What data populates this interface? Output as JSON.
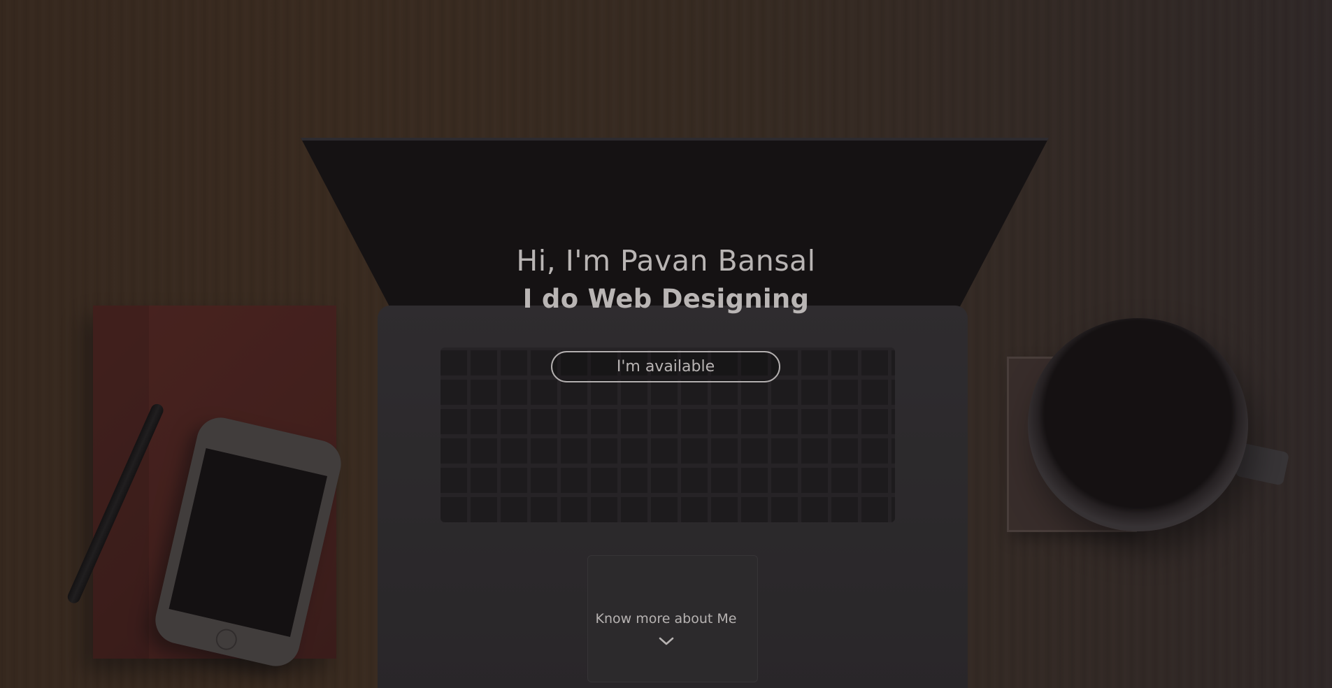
{
  "hero": {
    "greeting": "Hi, I'm Pavan Bansal",
    "tagline": "I do Web Designing",
    "cta_label": "I'm available",
    "scroll_label": "Know more about Me",
    "scroll_icon": "chevron-down-icon"
  },
  "colors": {
    "text": "#b9b5b4",
    "button_border": "#b3afaf"
  }
}
